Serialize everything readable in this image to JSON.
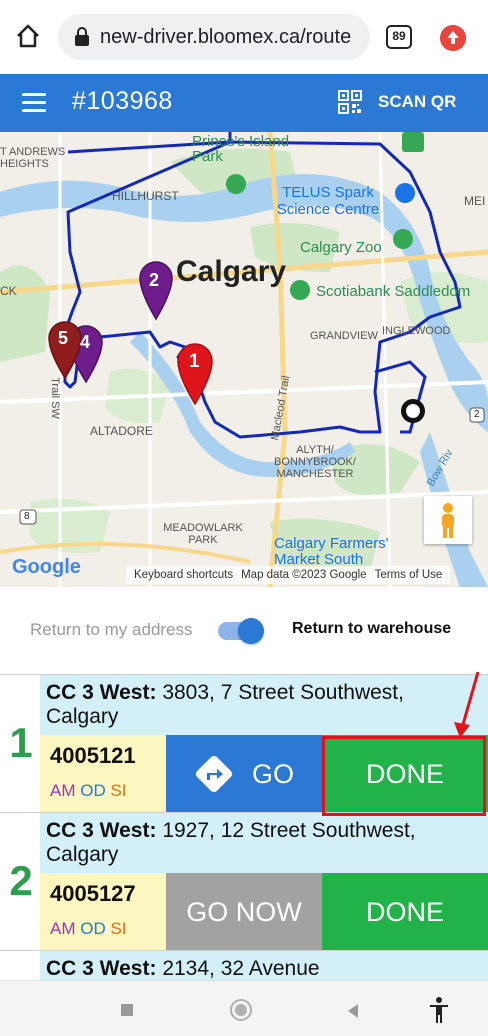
{
  "browser": {
    "url": "new-driver.bloomex.ca/route",
    "tab_count": "89"
  },
  "header": {
    "order_id": "#103968",
    "scan_label": "SCAN QR"
  },
  "map": {
    "labels": {
      "andrews": "T ANDREWS",
      "heights": "HEIGHTS",
      "princes_island": "Prince's Island Park",
      "hillhurst": "HILLHURST",
      "telus": "TELUS Spark Science Centre",
      "mei": "MEI",
      "calgary_zoo": "Calgary Zoo",
      "calgary": "Calgary",
      "scotiabank": "Scotiabank Saddledom",
      "ck": "CK",
      "grandview": "GRANDVIEW",
      "inglewood": "INGLEWOOD",
      "macleod": "Macleod Trail",
      "trail_sw": "Trail SW",
      "altadore": "ALTADORE",
      "alyth": "ALYTH/ BONNYBROOK/ MANCHESTER",
      "bow_river": "Bow Riv",
      "meadowlark": "MEADOWLARK PARK",
      "farmers_market": "Calgary Farmers' Market South",
      "route_8": "8",
      "route_2": "2"
    },
    "markers": [
      "1",
      "2",
      "4",
      "5"
    ],
    "google": "Google",
    "footer": {
      "shortcuts": "Keyboard shortcuts",
      "map_data": "Map data ©2023 Google",
      "terms": "Terms of Use"
    },
    "zoom_in": "+",
    "zoom_out": "−"
  },
  "return_toggle": {
    "left_label": "Return to my address",
    "right_label": "Return to warehouse",
    "state": "on"
  },
  "stops": [
    {
      "number": "1",
      "prefix": "CC 3 West:",
      "address": "3803, 7 Street Southwest, Calgary",
      "code": "4005121",
      "flag_am": "AM",
      "flag_od": "OD",
      "flag_si": "SI",
      "go_label": "GO",
      "done_label": "DONE"
    },
    {
      "number": "2",
      "prefix": "CC 3 West:",
      "address": "1927, 12 Street Southwest, Calgary",
      "code": "4005127",
      "flag_am": "AM",
      "flag_od": "OD",
      "flag_si": "SI",
      "go_label": "GO NOW",
      "done_label": "DONE"
    },
    {
      "prefix": "CC 3 West:",
      "address": "2134, 32 Avenue"
    }
  ],
  "colors": {
    "brand_blue": "#2b79d4",
    "done_green": "#21b249",
    "go_now_grey": "#a2a2a2",
    "address_bg": "#d3f0f8",
    "code_bg": "#fcf6c1",
    "highlight_red": "#e0131b"
  },
  "icons": {
    "home": "home-icon",
    "lock": "lock-icon",
    "menu": "menu-icon",
    "qr": "qr-code-icon",
    "directions": "directions-icon",
    "pegman": "pegman-icon"
  }
}
